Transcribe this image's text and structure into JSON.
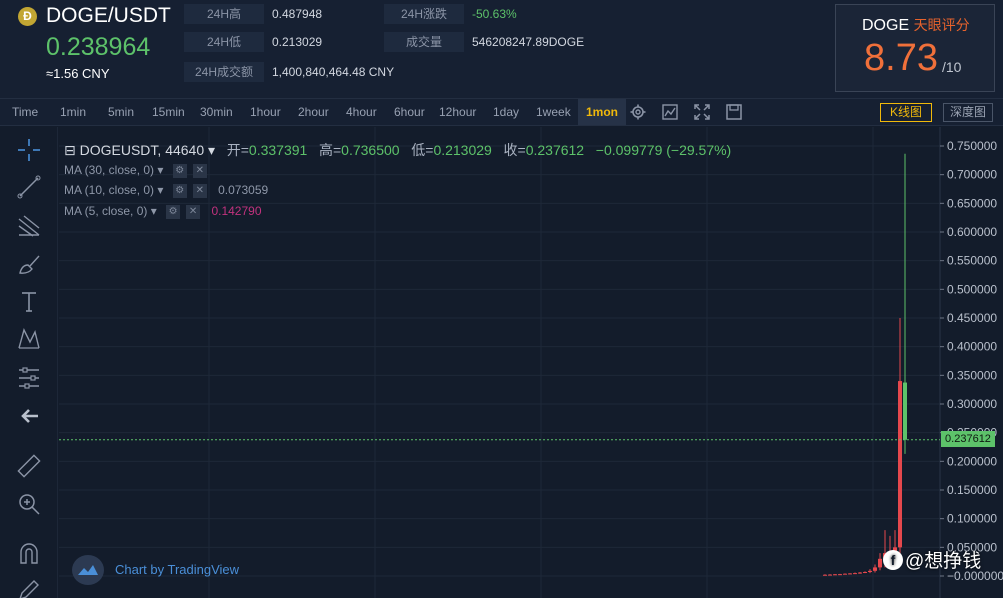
{
  "header": {
    "coin_icon_glyph": "Đ",
    "pair": "DOGE/USDT",
    "last_price": "0.238964",
    "cny": "≈1.56 CNY",
    "stats": {
      "high_label": "24H高",
      "high_value": "0.487948",
      "change_label": "24H涨跌",
      "change_value": "-50.63%",
      "low_label": "24H低",
      "low_value": "0.213029",
      "volume_label": "成交量",
      "volume_value": "546208247.89DOGE",
      "turnover_label": "24H成交额",
      "turnover_value": "1,400,840,464.48 CNY"
    },
    "rating": {
      "coin": "DOGE",
      "title": "天眼评分",
      "score": "8.73",
      "out_of": "/10"
    }
  },
  "toolbar": {
    "timeframes": [
      "Time",
      "1min",
      "5min",
      "15min",
      "30min",
      "1hour",
      "2hour",
      "4hour",
      "6hour",
      "12hour",
      "1day",
      "1week",
      "1mon"
    ],
    "active_timeframe": "1mon",
    "icons": [
      "gear-icon",
      "indicator-icon",
      "fullscreen-icon",
      "save-icon"
    ],
    "kline_label": "K线图",
    "depth_label": "深度图"
  },
  "tools": [
    "crosshair-icon",
    "trend-line-icon",
    "fib-icon",
    "brush-icon",
    "text-icon",
    "pattern-icon",
    "measure-icon",
    "back-arrow-icon",
    "ruler-icon",
    "zoom-in-icon",
    "magnet-icon",
    "pencil-icon"
  ],
  "legend": {
    "symbol": "DOGEUSDT, 44640",
    "open_label": "开=",
    "open": "0.337391",
    "high_label": "高=",
    "high": "0.736500",
    "low_label": "低=",
    "low": "0.213029",
    "close_label": "收=",
    "close": "0.237612",
    "change": "−0.099779 (−29.57%)",
    "ma": [
      {
        "label": "MA (30, close, 0)",
        "value": "",
        "color": "#8e97a8"
      },
      {
        "label": "MA (10, close, 0)",
        "value": "0.073059",
        "color": "#8e97a8"
      },
      {
        "label": "MA (5, close, 0)",
        "value": "0.142790",
        "color": "#c2327e"
      }
    ]
  },
  "chart_data": {
    "type": "candlestick",
    "y_ticks": [
      "0.750000",
      "0.700000",
      "0.650000",
      "0.600000",
      "0.550000",
      "0.500000",
      "0.450000",
      "0.400000",
      "0.350000",
      "0.300000",
      "0.250000",
      "0.200000",
      "0.150000",
      "0.100000",
      "0.050000",
      "−0.000000"
    ],
    "ylim": [
      0,
      0.75
    ],
    "last_price_tag": "0.237612",
    "candles": [
      {
        "o": 0.002,
        "h": 0.003,
        "l": 0.0015,
        "c": 0.0022,
        "dir": "up"
      },
      {
        "o": 0.0022,
        "h": 0.0032,
        "l": 0.0018,
        "c": 0.0025,
        "dir": "up"
      },
      {
        "o": 0.0025,
        "h": 0.0035,
        "l": 0.002,
        "c": 0.003,
        "dir": "up"
      },
      {
        "o": 0.003,
        "h": 0.0038,
        "l": 0.0025,
        "c": 0.0032,
        "dir": "up"
      },
      {
        "o": 0.0032,
        "h": 0.0045,
        "l": 0.0028,
        "c": 0.004,
        "dir": "up"
      },
      {
        "o": 0.004,
        "h": 0.005,
        "l": 0.003,
        "c": 0.0045,
        "dir": "up"
      },
      {
        "o": 0.0045,
        "h": 0.006,
        "l": 0.0035,
        "c": 0.005,
        "dir": "up"
      },
      {
        "o": 0.005,
        "h": 0.007,
        "l": 0.004,
        "c": 0.006,
        "dir": "up"
      },
      {
        "o": 0.006,
        "h": 0.008,
        "l": 0.005,
        "c": 0.007,
        "dir": "up"
      },
      {
        "o": 0.007,
        "h": 0.012,
        "l": 0.005,
        "c": 0.009,
        "dir": "up"
      },
      {
        "o": 0.009,
        "h": 0.02,
        "l": 0.006,
        "c": 0.015,
        "dir": "up"
      },
      {
        "o": 0.015,
        "h": 0.04,
        "l": 0.01,
        "c": 0.03,
        "dir": "up"
      },
      {
        "o": 0.03,
        "h": 0.08,
        "l": 0.015,
        "c": 0.04,
        "dir": "up"
      },
      {
        "o": 0.04,
        "h": 0.07,
        "l": 0.02,
        "c": 0.035,
        "dir": "up"
      },
      {
        "o": 0.035,
        "h": 0.08,
        "l": 0.025,
        "c": 0.05,
        "dir": "up"
      },
      {
        "o": 0.05,
        "h": 0.45,
        "l": 0.035,
        "c": 0.34,
        "dir": "up"
      },
      {
        "o": 0.3374,
        "h": 0.7365,
        "l": 0.213,
        "c": 0.2376,
        "dir": "down"
      }
    ],
    "colors": {
      "up": "#e5484d",
      "down": "#5dc26a",
      "grid": "#1e2838",
      "axis_text": "#b9c0cc"
    }
  },
  "tradingview_text": "Chart by TradingView",
  "watermark": {
    "logo_glyph": "f",
    "text": "@想挣钱"
  }
}
